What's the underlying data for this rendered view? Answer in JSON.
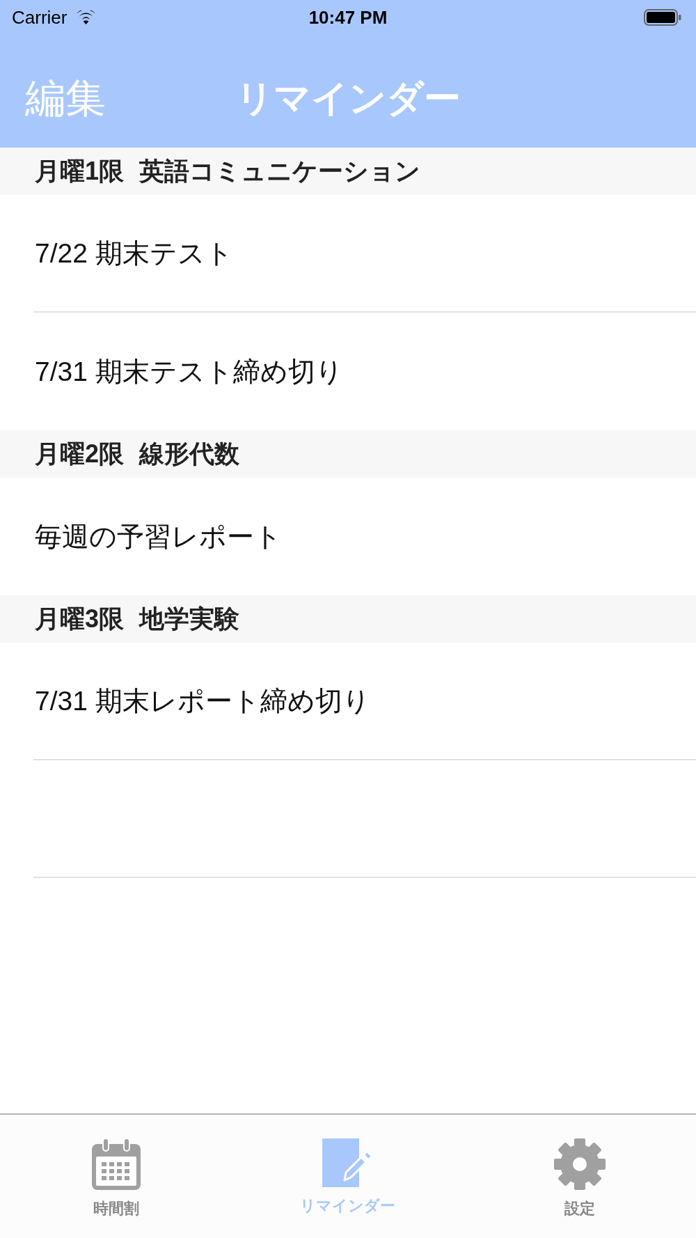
{
  "status_bar": {
    "carrier": "Carrier",
    "time": "10:47 PM"
  },
  "nav_bar": {
    "edit_button": "編集",
    "title": "リマインダー"
  },
  "sections": [
    {
      "period": "月曜1限",
      "course": "英語コミュニケーション",
      "rows": [
        "7/22 期末テスト",
        "7/31 期末テスト締め切り"
      ]
    },
    {
      "period": "月曜2限",
      "course": "線形代数",
      "rows": [
        "毎週の予習レポート"
      ]
    },
    {
      "period": "月曜3限",
      "course": "地学実験",
      "rows": [
        "7/31 期末レポート締め切り"
      ]
    }
  ],
  "tab_bar": [
    {
      "label": "時間割",
      "selected": false
    },
    {
      "label": "リマインダー",
      "selected": true
    },
    {
      "label": "設定",
      "selected": false
    }
  ]
}
